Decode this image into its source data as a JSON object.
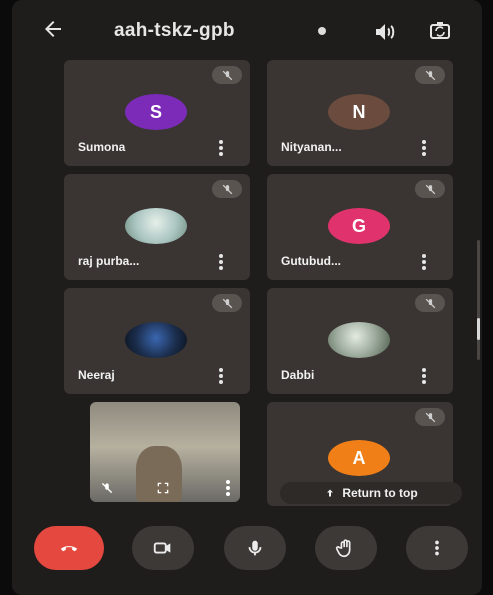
{
  "header": {
    "meeting_code": "aah-tskz-gpb",
    "back_icon": "arrow-left-icon",
    "audio_icon": "speaker-icon",
    "switch_camera_icon": "camera-switch-icon"
  },
  "participants": [
    {
      "name": "Sumona",
      "initial": "S",
      "avatar_color": "#7b2bb8",
      "muted": true
    },
    {
      "name": "Nityanan...",
      "initial": "N",
      "avatar_color": "#6b4b3e",
      "muted": true
    },
    {
      "name": "raj purba...",
      "initial": "",
      "avatar_color": "#a9c4c0",
      "muted": true
    },
    {
      "name": "Gutubud...",
      "initial": "G",
      "avatar_color": "#e0336d",
      "muted": true
    },
    {
      "name": "Neeraj",
      "initial": "",
      "avatar_color": "#1b2d4c",
      "muted": true
    },
    {
      "name": "Dabbi",
      "initial": "",
      "avatar_color": "#9aa89a",
      "muted": true
    },
    {
      "name": "",
      "initial": "A",
      "avatar_color": "#f07f18",
      "muted": true
    }
  ],
  "return_to_top": "Return to top",
  "controls": {
    "end_call_icon": "end-call-icon",
    "camera_icon": "video-camera-icon",
    "mic_icon": "microphone-icon",
    "hand_icon": "raise-hand-icon",
    "more_icon": "more-vert-icon"
  },
  "colors": {
    "end_call": "#e5483e",
    "tile_bg": "#3a3532",
    "screen_bg": "#1f1d1c"
  }
}
